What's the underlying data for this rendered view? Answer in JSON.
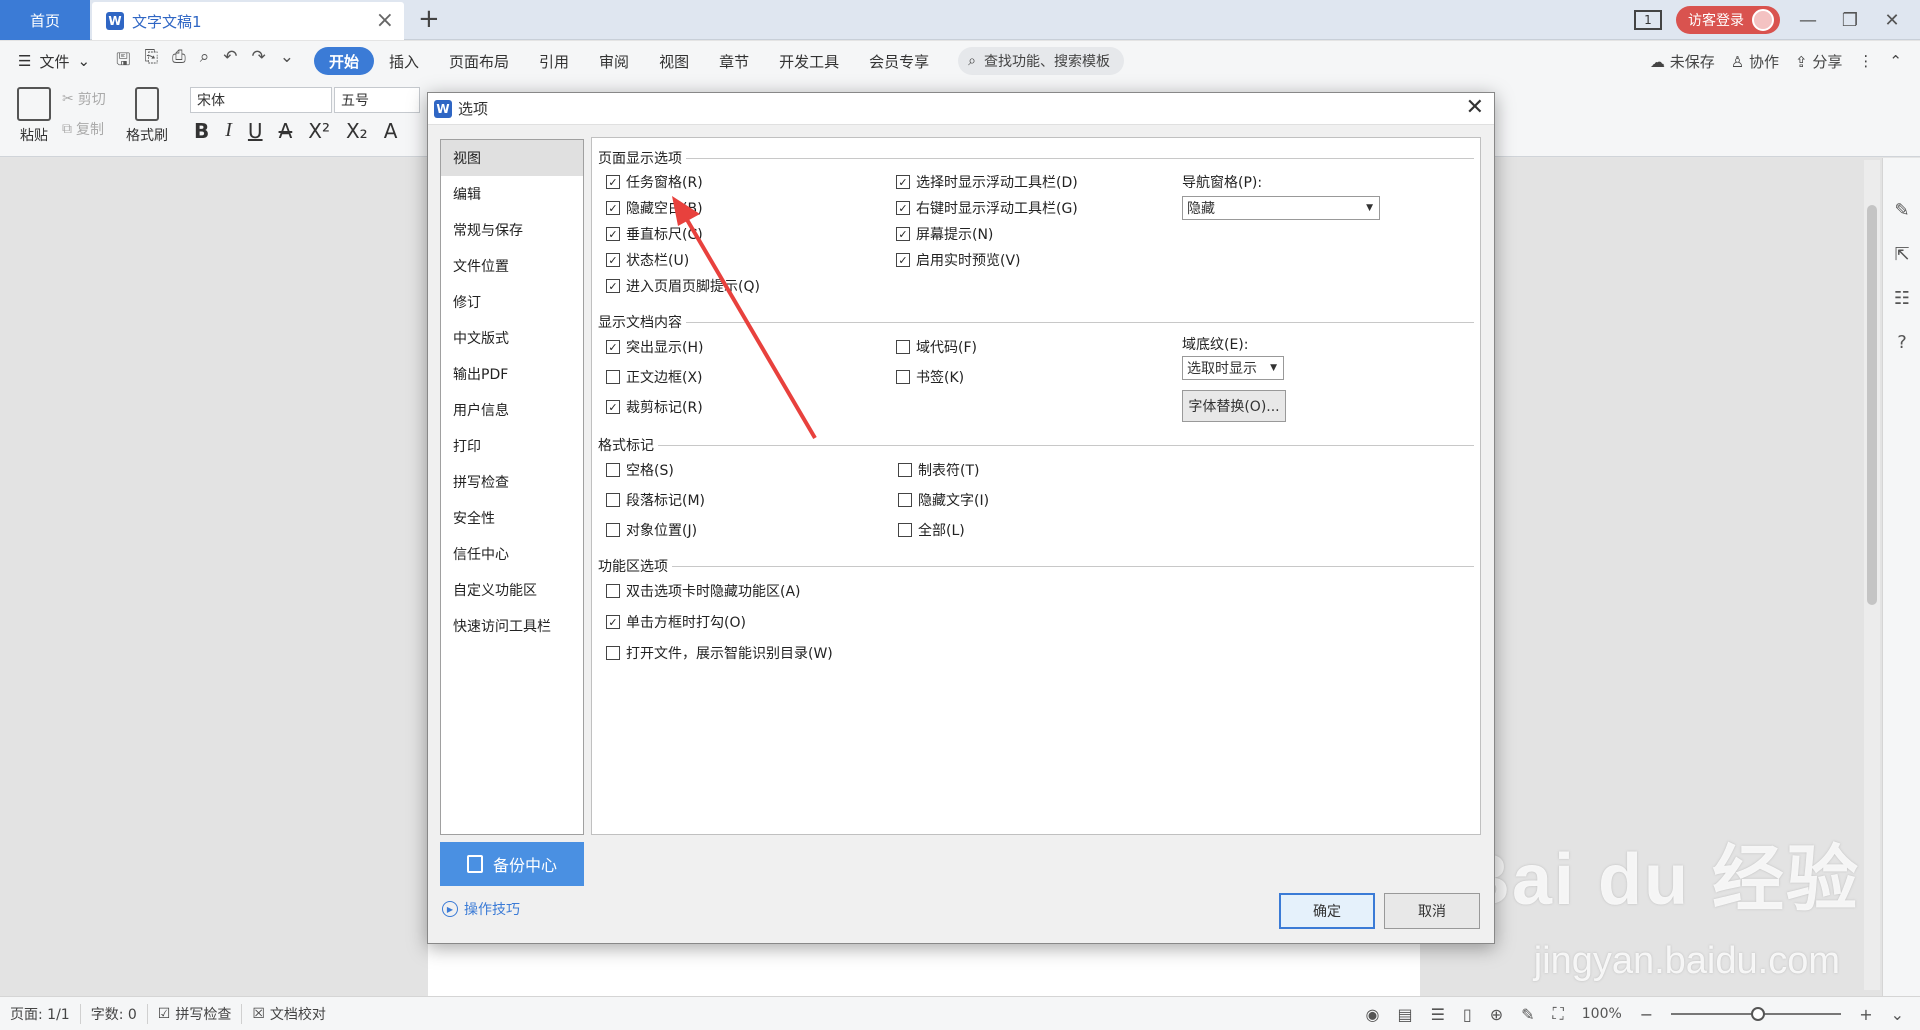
{
  "tabs": {
    "home": "首页",
    "doc": "文字文稿1",
    "page_indicator": "1",
    "login": "访客登录"
  },
  "menubar": {
    "file": "文件",
    "tabs": [
      "开始",
      "插入",
      "页面布局",
      "引用",
      "审阅",
      "视图",
      "章节",
      "开发工具",
      "会员专享"
    ],
    "search": "查找功能、搜索模板",
    "unsaved": "未保存",
    "collab": "协作",
    "share": "分享"
  },
  "ribbon": {
    "paste": "粘贴",
    "cut": "剪切",
    "copy": "复制",
    "format_painter": "格式刷",
    "font": "宋体",
    "size": "五号"
  },
  "dialog": {
    "title": "选项",
    "nav": [
      "视图",
      "编辑",
      "常规与保存",
      "文件位置",
      "修订",
      "中文版式",
      "输出PDF",
      "用户信息",
      "打印",
      "拼写检查",
      "安全性",
      "信任中心",
      "自定义功能区",
      "快速访问工具栏"
    ],
    "backup": "备份中心",
    "tips": "操作技巧",
    "ok": "确定",
    "cancel": "取消",
    "sections": {
      "page_display": "页面显示选项",
      "doc_content": "显示文档内容",
      "format_marks": "格式标记",
      "ribbon_options": "功能区选项"
    },
    "page_display": {
      "col1": [
        {
          "label": "任务窗格(R)",
          "checked": true
        },
        {
          "label": "隐藏空白(B)",
          "checked": true
        },
        {
          "label": "垂直标尺(C)",
          "checked": true
        },
        {
          "label": "状态栏(U)",
          "checked": true
        },
        {
          "label": "进入页眉页脚提示(Q)",
          "checked": true
        }
      ],
      "col2": [
        {
          "label": "选择时显示浮动工具栏(D)",
          "checked": true
        },
        {
          "label": "右键时显示浮动工具栏(G)",
          "checked": true
        },
        {
          "label": "屏幕提示(N)",
          "checked": true
        },
        {
          "label": "启用实时预览(V)",
          "checked": true
        }
      ],
      "nav_pane_label": "导航窗格(P):",
      "nav_pane_value": "隐藏"
    },
    "doc_content": {
      "col1": [
        {
          "label": "突出显示(H)",
          "checked": true
        },
        {
          "label": "正文边框(X)",
          "checked": false
        },
        {
          "label": "裁剪标记(R)",
          "checked": true
        }
      ],
      "col2": [
        {
          "label": "域代码(F)",
          "checked": false
        },
        {
          "label": "书签(K)",
          "checked": false
        }
      ],
      "field_shading_label": "域底纹(E):",
      "field_shading_value": "选取时显示",
      "font_subst": "字体替换(O)..."
    },
    "format_marks": {
      "col1": [
        {
          "label": "空格(S)",
          "checked": false
        },
        {
          "label": "段落标记(M)",
          "checked": false
        },
        {
          "label": "对象位置(J)",
          "checked": false
        }
      ],
      "col2": [
        {
          "label": "制表符(T)",
          "checked": false
        },
        {
          "label": "隐藏文字(I)",
          "checked": false
        },
        {
          "label": "全部(L)",
          "checked": false
        }
      ]
    },
    "ribbon_options": [
      {
        "label": "双击选项卡时隐藏功能区(A)",
        "checked": false
      },
      {
        "label": "单击方框时打勾(O)",
        "checked": true
      },
      {
        "label": "打开文件，展示智能识别目录(W)",
        "checked": false
      }
    ]
  },
  "statusbar": {
    "page": "页面: 1/1",
    "words": "字数: 0",
    "spell": "拼写检查",
    "proof": "文档校对",
    "zoom": "100%"
  },
  "watermark": {
    "main": "Bai du 经验",
    "sub": "jingyan.baidu.com"
  },
  "colors": {
    "accent": "#3b7bd6",
    "annotation_arrow": "#e8413d"
  }
}
